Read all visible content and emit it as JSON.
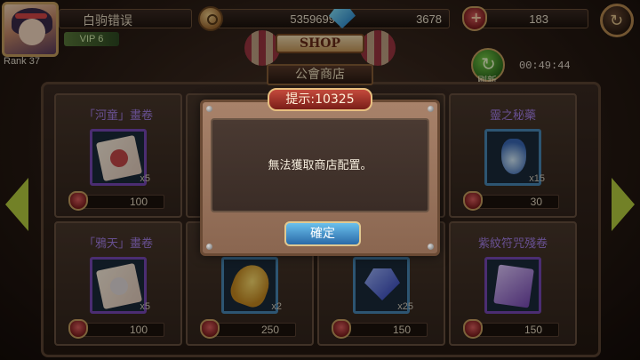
{
  "player": {
    "name": "白驹错误",
    "vip": "VIP 6",
    "rank": "Rank 37"
  },
  "resources": {
    "gold": "5359699",
    "gems": "3678",
    "guild_points": "183"
  },
  "shop": {
    "sign": "SHOP",
    "title": "公會商店",
    "refresh_label": "刷新",
    "timer": "00:49:44"
  },
  "items": [
    {
      "name": "「河童」畫卷",
      "qty": "x5",
      "price": "100"
    },
    {
      "name": "",
      "qty": "",
      "price": ""
    },
    {
      "name": "",
      "qty": "",
      "price": ""
    },
    {
      "name": "靈之秘藥",
      "qty": "x15",
      "price": "30"
    },
    {
      "name": "「鴉天」畫卷",
      "qty": "x5",
      "price": "100"
    },
    {
      "name": "",
      "qty": "x2",
      "price": "250"
    },
    {
      "name": "",
      "qty": "x25",
      "price": "150"
    },
    {
      "name": "紫紋符咒殘卷",
      "qty": "",
      "price": "150"
    }
  ],
  "dialog": {
    "title": "提示:10325",
    "message": "無法獲取商店配置。",
    "confirm_label": "確定"
  },
  "colors": {
    "accent_blue": "#2a6aa8",
    "title_red": "#c44a3c",
    "item_name_purple": "#a680e8",
    "nav_arrow_green": "#b8d040"
  }
}
